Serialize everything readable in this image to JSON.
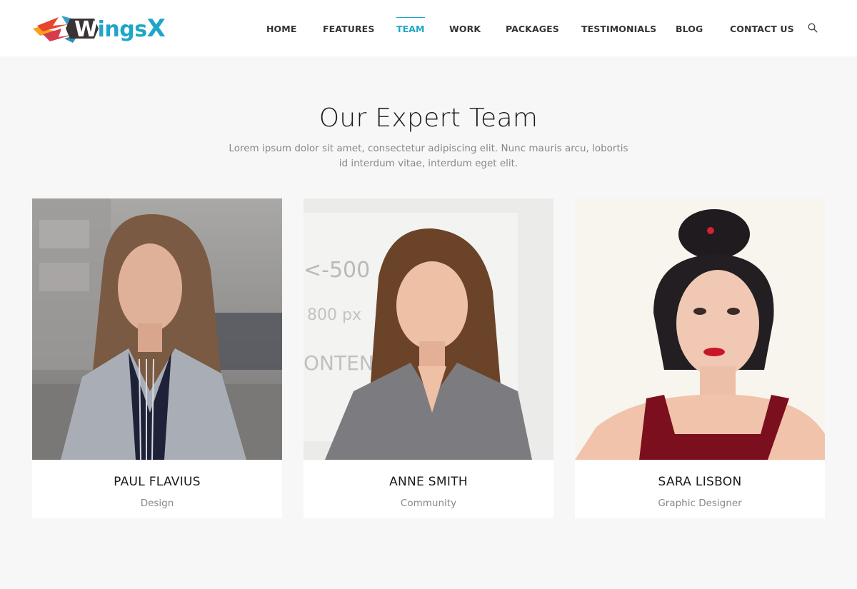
{
  "brand": {
    "name": "WingsX",
    "name_parts": [
      "W",
      "ings",
      "X"
    ],
    "accent_color": "#1ea6c8"
  },
  "nav": {
    "items": [
      {
        "label": "HOME",
        "active": false
      },
      {
        "label": "FEATURES",
        "active": false
      },
      {
        "label": "TEAM",
        "active": true
      },
      {
        "label": "WORK",
        "active": false
      },
      {
        "label": "PACKAGES",
        "active": false
      },
      {
        "label": "TESTIMONIALS",
        "active": false
      },
      {
        "label": "BLOG",
        "active": false
      },
      {
        "label": "CONTACT US",
        "active": false
      }
    ],
    "search_icon": "search-icon"
  },
  "section": {
    "title": "Our Expert Team",
    "subtitle": "Lorem ipsum dolor sit amet, consectetur adipiscing elit. Nunc mauris arcu, lobortis id interdum vitae, interdum eget elit."
  },
  "team": [
    {
      "name": "PAUL FLAVIUS",
      "role": "Design",
      "photo": "woman in grey plaid blazer on city street"
    },
    {
      "name": "ANNE SMITH",
      "role": "Community",
      "photo": "smiling woman in grey jacket before whiteboard"
    },
    {
      "name": "SARA LISBON",
      "role": "Graphic Designer",
      "photo": "woman with hair bun in red top"
    }
  ],
  "colors": {
    "background": "#f7f7f7",
    "header": "#ffffff",
    "text_dark": "#1a1a1a",
    "text_muted": "#888888",
    "nav_text": "#333333"
  }
}
